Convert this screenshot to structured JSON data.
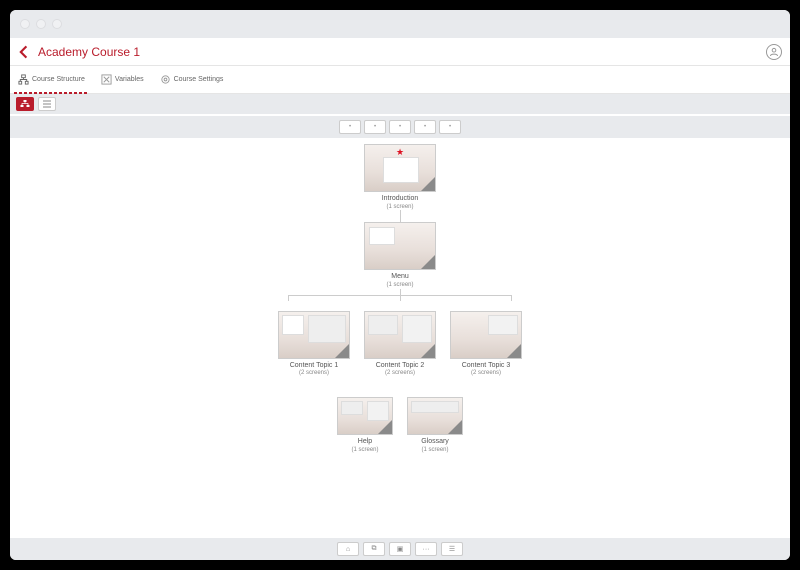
{
  "header": {
    "course_title": "Academy Course 1"
  },
  "tabs": {
    "structure": "Course Structure",
    "variables": "Variables",
    "settings": "Course Settings"
  },
  "toolbar_buttons": [
    "+",
    "+",
    "+",
    "+",
    "+"
  ],
  "nodes": {
    "intro": {
      "title": "Introduction",
      "count": "(1 screen)"
    },
    "menu": {
      "title": "Menu",
      "count": "(1 screen)"
    },
    "topic1": {
      "title": "Content Topic 1",
      "count": "(2 screens)"
    },
    "topic2": {
      "title": "Content Topic 2",
      "count": "(2 screens)"
    },
    "topic3": {
      "title": "Content Topic 3",
      "count": "(2 screens)"
    },
    "help": {
      "title": "Help",
      "count": "(1 screen)"
    },
    "glossary": {
      "title": "Glossary",
      "count": "(1 screen)"
    }
  },
  "footer_buttons": [
    "⌂",
    "⧉",
    "▣",
    "···",
    "☰"
  ]
}
